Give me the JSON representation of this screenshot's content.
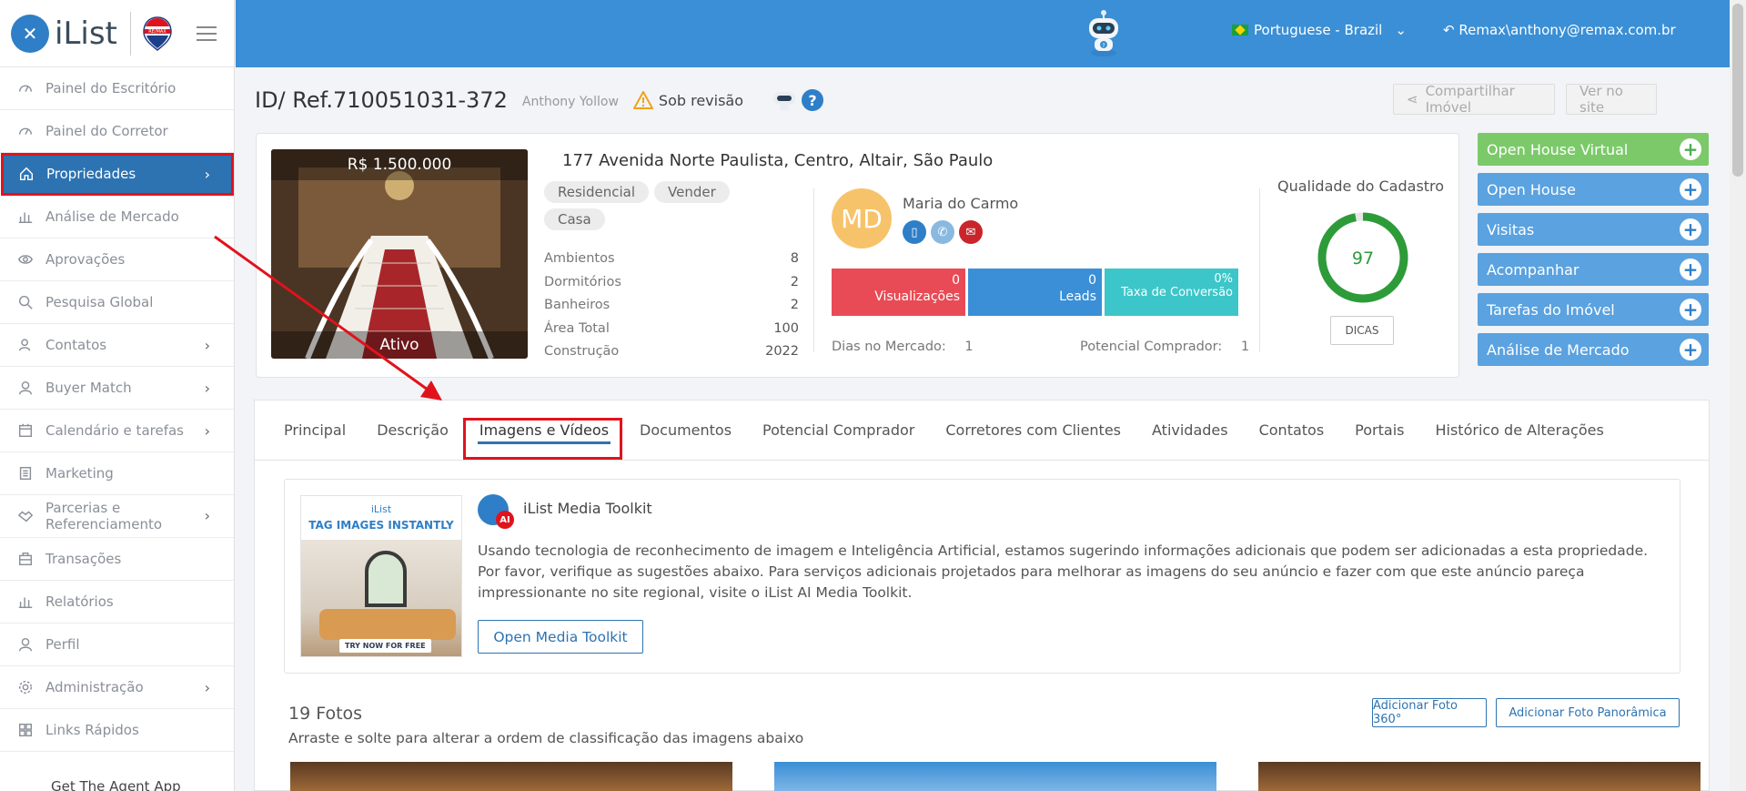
{
  "brand": {
    "logo_text": "iList",
    "logo_letter": "✕"
  },
  "topbar": {
    "language": "Portuguese - Brazil",
    "user": "Remax\\anthony@remax.com.br"
  },
  "sidebar": {
    "items": [
      {
        "label": "Painel do Escritório",
        "icon": "dashboard-icon"
      },
      {
        "label": "Painel do Corretor",
        "icon": "dashboard-icon"
      },
      {
        "label": "Propriedades",
        "icon": "home-icon",
        "active": true
      },
      {
        "label": "Análise de Mercado",
        "icon": "bar-chart-icon"
      },
      {
        "label": "Aprovações",
        "icon": "eye-icon"
      },
      {
        "label": "Pesquisa Global",
        "icon": "search-icon"
      },
      {
        "label": "Contatos",
        "icon": "contacts-icon"
      },
      {
        "label": "Buyer Match",
        "icon": "user-icon"
      },
      {
        "label": "Calendário e tarefas",
        "icon": "calendar-icon"
      },
      {
        "label": "Marketing",
        "icon": "book-icon"
      },
      {
        "label": "Parcerias e Referenciamento",
        "icon": "handshake-icon"
      },
      {
        "label": "Transações",
        "icon": "briefcase-icon"
      },
      {
        "label": "Relatórios",
        "icon": "bar-chart-icon"
      },
      {
        "label": "Perfil",
        "icon": "user-icon"
      },
      {
        "label": "Administração",
        "icon": "gear-icon"
      },
      {
        "label": "Links Rápidos",
        "icon": "grid-icon"
      }
    ],
    "agent_app": "Get The Agent App"
  },
  "header": {
    "property_id": "ID/ Ref.710051031-372",
    "agent": "Anthony Yollow",
    "status": "Sob revisão",
    "share_button": "Compartilhar Imóvel",
    "view_site_button": "Ver no site"
  },
  "summary": {
    "price": "R$ 1.500.000",
    "photo_status": "Ativo",
    "address": "177 Avenida Norte Paulista, Centro, Altair, São Paulo",
    "chips": [
      "Residencial",
      "Vender",
      "Casa"
    ],
    "stats": [
      {
        "label": "Ambientos",
        "value": "8"
      },
      {
        "label": "Dormitórios",
        "value": "2"
      },
      {
        "label": "Banheiros",
        "value": "2"
      },
      {
        "label": "Área Total",
        "value": "100"
      },
      {
        "label": "Construção",
        "value": "2022"
      }
    ],
    "agent_initials": "MD",
    "agent_name": "Maria do Carmo",
    "metrics": [
      {
        "value": "0",
        "label": "Visualizações",
        "color": "#e84b55"
      },
      {
        "value": "0",
        "label": "Leads",
        "color": "#3a8fd6"
      },
      {
        "value": "0%",
        "label": "Taxa de Conversão",
        "color": "#3cc6c9"
      }
    ],
    "dias_label": "Dias no Mercado:",
    "dias_value": "1",
    "pot_label": "Potencial Comprador:",
    "pot_value": "1",
    "quality_title": "Qualidade do Cadastro",
    "quality_score": "97",
    "quality_fraction": 0.97,
    "tips_button": "DICAS"
  },
  "actions": [
    {
      "label": "Open House Virtual",
      "color": "#7cc96a",
      "plus_color": "#4caf50"
    },
    {
      "label": "Open House",
      "color": "#5aa2e0",
      "plus_color": "#2e7fc7"
    },
    {
      "label": "Visitas",
      "color": "#5aa2e0",
      "plus_color": "#2e7fc7"
    },
    {
      "label": "Acompanhar",
      "color": "#5aa2e0",
      "plus_color": "#2e7fc7"
    },
    {
      "label": "Tarefas do Imóvel",
      "color": "#5aa2e0",
      "plus_color": "#2e7fc7"
    },
    {
      "label": "Análise de Mercado",
      "color": "#5aa2e0",
      "plus_color": "#2e7fc7"
    }
  ],
  "tabs": [
    {
      "label": "Principal"
    },
    {
      "label": "Descrição"
    },
    {
      "label": "Imagens e Vídeos",
      "active": true
    },
    {
      "label": "Documentos"
    },
    {
      "label": "Potencial Comprador"
    },
    {
      "label": "Corretores com Clientes"
    },
    {
      "label": "Atividades"
    },
    {
      "label": "Contatos"
    },
    {
      "label": "Portais"
    },
    {
      "label": "Histórico de Alterações"
    }
  ],
  "toolkit": {
    "promo_brand": "iList",
    "promo_tag": "TAG IMAGES INSTANTLY",
    "promo_try": "TRY NOW FOR FREE",
    "ai_badge": "AI",
    "title": "iList Media Toolkit",
    "description": "Usando tecnologia de reconhecimento de imagem e Inteligência Artificial, estamos sugerindo informações adicionais que podem ser adicionadas a esta propriedade. Por favor, verifique as sugestões abaixo. Para serviços adicionais projetados para melhorar as imagens do seu anúncio e fazer com que este anúncio pareça impressionante no site regional, visite o iList AI Media Toolkit.",
    "button": "Open Media Toolkit"
  },
  "photos": {
    "title": "19 Fotos",
    "subtitle": "Arraste e solte para alterar a ordem de classificação das imagens abaixo",
    "add_360": "Adicionar Foto 360°",
    "add_panoramic": "Adicionar Foto Panorâmica"
  }
}
